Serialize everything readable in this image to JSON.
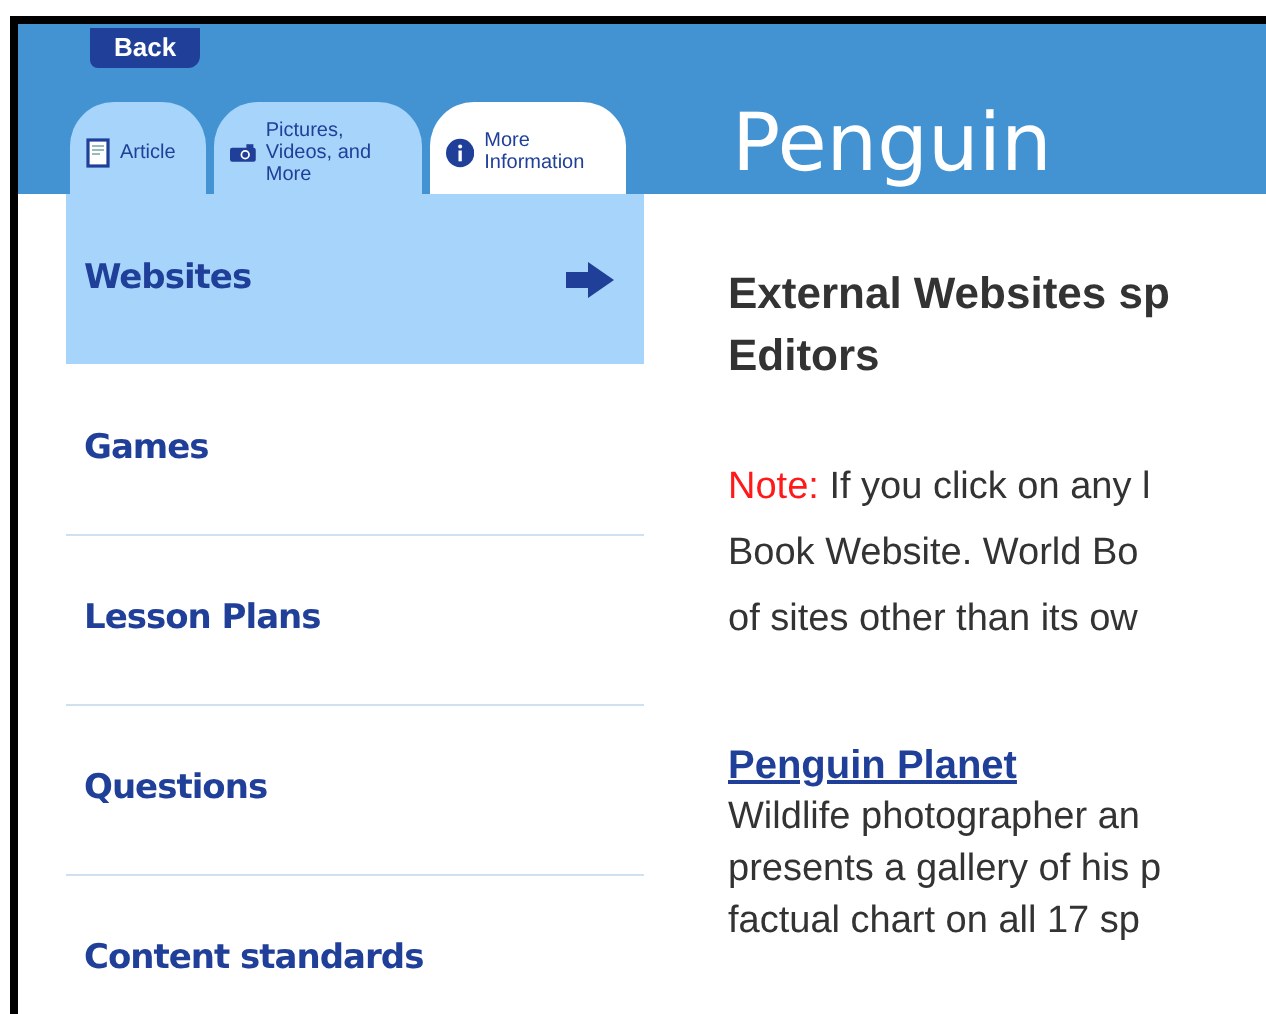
{
  "back_button": {
    "label": "Back"
  },
  "tabs": [
    {
      "kind": "article",
      "label": "Article",
      "selected": false
    },
    {
      "kind": "media",
      "label": "Pictures, Videos, and More",
      "selected": false
    },
    {
      "kind": "info",
      "label": "More Information",
      "selected": true
    }
  ],
  "page_title": "Penguin",
  "sidebar": {
    "items": [
      {
        "label": "Websites",
        "selected": true
      },
      {
        "label": "Games",
        "selected": false
      },
      {
        "label": "Lesson Plans",
        "selected": false
      },
      {
        "label": "Questions",
        "selected": false
      },
      {
        "label": "Content standards",
        "selected": false
      }
    ]
  },
  "content": {
    "heading_lines": [
      "External Websites sp",
      "Editors"
    ],
    "note": {
      "label": "Note:",
      "lines": [
        "If you click on any l",
        "Book Website. World Bo",
        "of sites other than its ow"
      ]
    },
    "websites": [
      {
        "title": "Penguin Planet",
        "lines": [
          "Wildlife photographer an",
          "presents a gallery of his p",
          "factual chart on all 17 sp"
        ]
      }
    ]
  }
}
